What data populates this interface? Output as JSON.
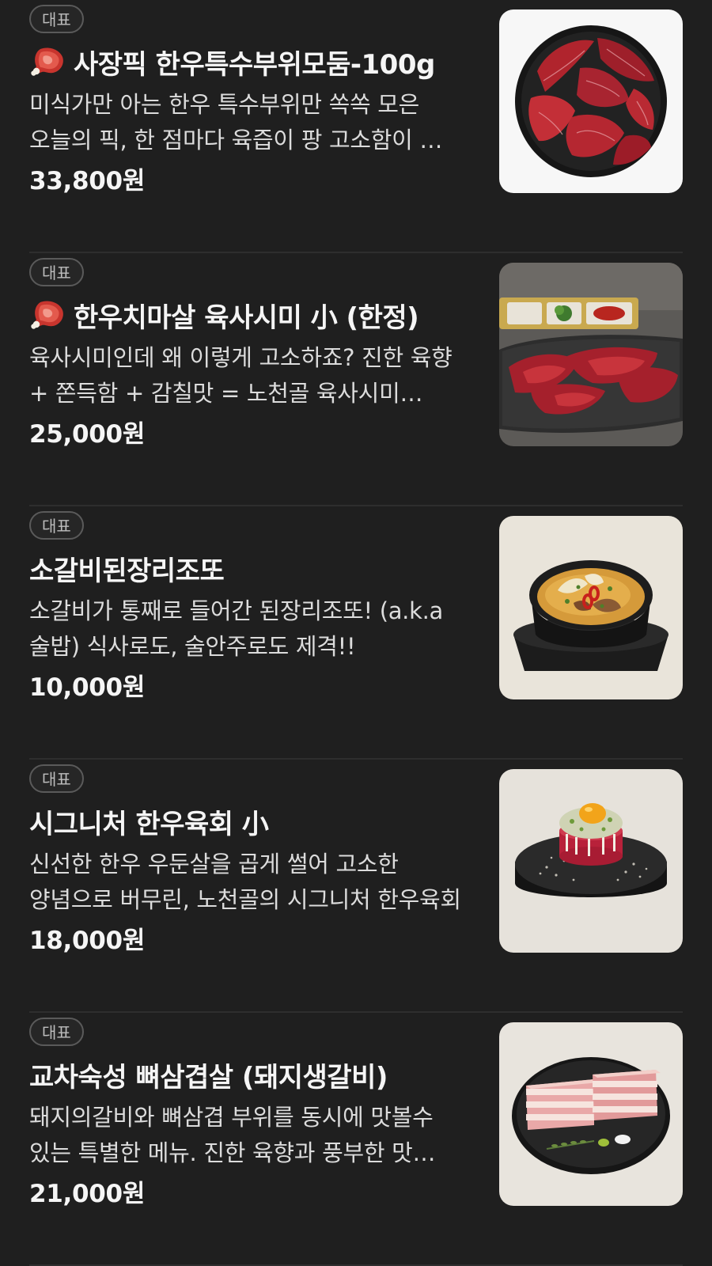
{
  "menu": {
    "items": [
      {
        "badge": "대표",
        "has_meat_icon": true,
        "title": "사장픽 한우특수부위모둠-100g",
        "description": "미식가만 아는 한우 특수부위만 쏙쏙 모은 오늘의 픽, 한 점마다 육즙이 팡 고소함이 …",
        "price": "33,800원",
        "image": "hanwoo-special-cuts-platter"
      },
      {
        "badge": "대표",
        "has_meat_icon": true,
        "title": "한우치마살 육사시미 小 (한정)",
        "description": "육사시미인데 왜 이렇게 고소하죠? 진한 육향 + 쫀득함 + 감칠맛 = 노천골 육사시미…",
        "price": "25,000원",
        "image": "beef-sashimi-slate"
      },
      {
        "badge": "대표",
        "has_meat_icon": false,
        "title": "소갈비된장리조또",
        "description": "소갈비가 통째로 들어간 된장리조또! (a.k.a 술밥) 식사로도, 술안주로도 제격!!",
        "price": "10,000원",
        "image": "doenjang-risotto-pot"
      },
      {
        "badge": "대표",
        "has_meat_icon": false,
        "title": "시그니처 한우육회 小",
        "description": "신선한 한우 우둔살을 곱게 썰어 고소한 양념으로 버무린, 노천골의 시그니처 한우육회",
        "price": "18,000원",
        "image": "beef-tartare-egg-yolk"
      },
      {
        "badge": "대표",
        "has_meat_icon": false,
        "title": "교차숙성 뼈삼겹살 (돼지생갈비)",
        "description": "돼지의갈비와 뼈삼겹 부위를 동시에 맛볼수 있는 특별한 메뉴. 진한 육향과 풍부한 맛…",
        "price": "21,000원",
        "image": "pork-belly-rib-plate"
      }
    ]
  }
}
